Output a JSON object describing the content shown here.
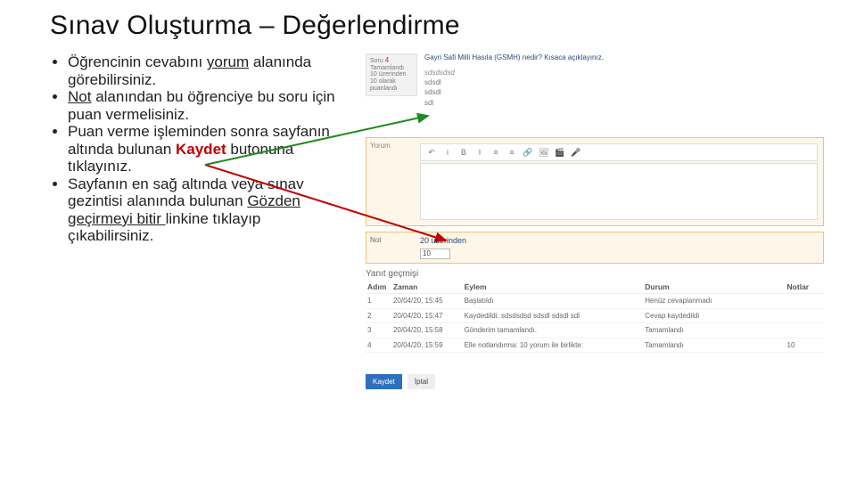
{
  "title": "Sınav Oluşturma – Değerlendirme",
  "bullets": {
    "b1a": "Öğrencinin cevabını ",
    "b1b": "yorum",
    "b1c": " alanında görebilirsiniz.",
    "b2a": "Not",
    "b2b": " alanından bu öğrenciye bu soru için puan vermelisiniz.",
    "b3a": "Puan verme işleminden sonra sayfanın altında bulunan ",
    "b3b": "Kaydet",
    "b3c": " butonuna tıklayınız.",
    "b4a": "Sayfanın en sağ altında veya sınav gezintisi alanında bulunan ",
    "b4b": "Gözden geçirmeyi bitir ",
    "b4c": "linkine tıklayıp çıkabilirsiniz."
  },
  "panel": {
    "question": {
      "label": "Soru",
      "num": "4",
      "status": "Tamamlandı",
      "mark_label": "10 üzerinden 10 olarak puanlandı"
    },
    "q_text": "Gayri Safi Milli Hasıla (GSMH) nedir? Kısaca açıklayınız.",
    "answer": {
      "sdsdsdsd": "sdsdsdsd",
      "sdsdl": "sdsdl",
      "sdl": "sdl"
    },
    "yorum_label": "Yorum",
    "toolbar": {
      "i1": "↶",
      "i2": "i",
      "i3": "B",
      "i4": "I",
      "i5": "≡",
      "i6": "≡",
      "i7": "🔗",
      "i8": "🖼",
      "i9": "🎬",
      "i10": "🎤"
    },
    "not": {
      "label": "Not",
      "current": "20 üzerinden",
      "value": "10",
      "total_prefix": ""
    },
    "history": {
      "title": "Yanıt geçmişi",
      "headers": {
        "adim": "Adım",
        "zaman": "Zaman",
        "eylem": "Eylem",
        "durum": "Durum",
        "notlar": "Notlar"
      },
      "rows": [
        {
          "a": "1",
          "z": "20/04/20, 15:45",
          "e": "Başlatıldı",
          "d": "Henüz cevaplanmadı",
          "n": ""
        },
        {
          "a": "2",
          "z": "20/04/20, 15:47",
          "e": "Kaydedildi: sdsdsdsd sdsdl sdsdl sdl",
          "d": "Cevap kaydedildi",
          "n": ""
        },
        {
          "a": "3",
          "z": "20/04/20, 15:58",
          "e": "Gönderim tamamlandı.",
          "d": "Tamamlandı",
          "n": ""
        },
        {
          "a": "4",
          "z": "20/04/20, 15:59",
          "e": "Elle notlandırma: 10 yorum ile birlikte:",
          "d": "Tamamlandı",
          "n": "10"
        }
      ]
    },
    "buttons": {
      "save": "Kaydet",
      "cancel": "İptal"
    }
  }
}
